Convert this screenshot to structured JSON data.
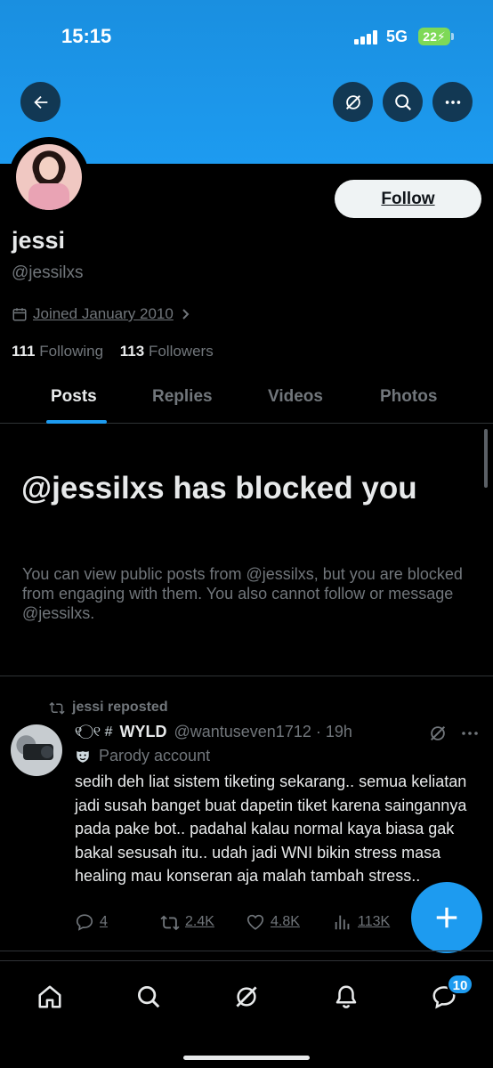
{
  "status_bar": {
    "time": "15:15",
    "network": "5G",
    "battery": "22"
  },
  "header": {
    "back_icon": "arrow-left-icon",
    "grok_icon": "grok-icon",
    "search_icon": "search-icon",
    "more_icon": "more-horizontal-icon"
  },
  "profile": {
    "display_name": "jessi",
    "handle": "@jessilxs",
    "joined": "Joined January 2010",
    "following_count": "111",
    "following_label": "Following",
    "followers_count": "113",
    "followers_label": "Followers",
    "follow_label": "Follow"
  },
  "tabs": [
    {
      "label": "Posts",
      "active": true
    },
    {
      "label": "Replies",
      "active": false
    },
    {
      "label": "Videos",
      "active": false
    },
    {
      "label": "Photos",
      "active": false
    }
  ],
  "blocked": {
    "title": "@jessilxs has blocked you",
    "body": "You can view public posts from @jessilxs, but you are blocked from engaging with them. You also cannot follow or message @jessilxs."
  },
  "post": {
    "repost_label": "jessi reposted",
    "author_emoji": "୧ ⃝ ୧ #",
    "author_name": "WYLD",
    "author_handle": "@wantuseven1712",
    "time": "19h",
    "meta_sep": "·",
    "parody_label": "Parody account",
    "text": "sedih deh liat sistem tiketing sekarang.. semua keliatan jadi susah banget buat dapetin tiket karena saingannya pada pake bot.. padahal kalau normal kaya biasa gak bakal sesusah itu.. udah jadi WNI bikin stress masa healing mau konseran aja malah tambah stress..",
    "replies": "4",
    "reposts": "2.4K",
    "likes": "4.8K",
    "views": "113K"
  },
  "nav": {
    "items": [
      "home-icon",
      "search-icon",
      "grok-icon",
      "notifications-icon",
      "messages-icon"
    ],
    "messages_badge": "10"
  },
  "colors": {
    "accent": "#1d9bf0",
    "banner": "#1d9bf0",
    "text_secondary": "#71767b",
    "background": "#000000"
  }
}
